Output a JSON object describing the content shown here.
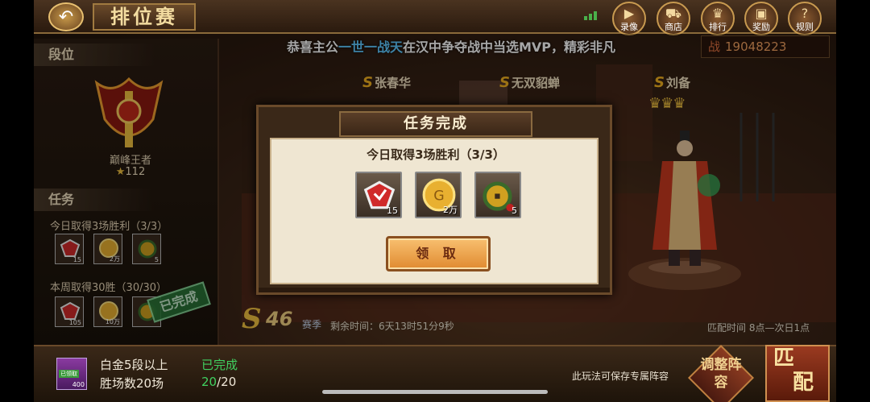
{
  "header": {
    "back_icon": "back-arrow-icon",
    "title": "排位赛",
    "nav": [
      {
        "label": "录像",
        "icon": "video-camera-icon"
      },
      {
        "label": "商店",
        "icon": "shopping-cart-icon"
      },
      {
        "label": "排行",
        "icon": "trophy-icon"
      },
      {
        "label": "奖励",
        "icon": "gift-icon"
      },
      {
        "label": "规则",
        "icon": "question-icon"
      }
    ]
  },
  "broadcast": {
    "prefix": "恭喜主公",
    "player": "一世一战天",
    "suffix": "在汉中争夺战中当选MVP，精彩非凡"
  },
  "power": {
    "label": "战",
    "value": "19048223"
  },
  "rank_panel": {
    "section_title": "段位",
    "rank_name": "巅峰王者",
    "stars": "112"
  },
  "tasks_panel": {
    "section_title": "任务",
    "tasks": [
      {
        "title": "今日取得3场胜利（3/3）",
        "rewards": [
          "15",
          "2万",
          "5"
        ]
      },
      {
        "title": "本周取得30胜（30/30）",
        "rewards": [
          "105",
          "10万",
          ""
        ],
        "stamp": "已完成"
      }
    ]
  },
  "arena": {
    "heroes": [
      "张春华",
      "无双貂蝉",
      "刘备"
    ],
    "season_letter": "S",
    "season_number": "46",
    "season_label": "赛季",
    "remaining": "剩余时间：6天13时51分9秒",
    "match_time": "匹配时间 8点—次日1点"
  },
  "dialog": {
    "title": "任务完成",
    "task": "今日取得3场胜利（3/3）",
    "rewards": [
      {
        "icon": "red-shield-token-icon",
        "count": "15"
      },
      {
        "icon": "gold-coin-icon",
        "count": "2万"
      },
      {
        "icon": "jade-coin-pendant-icon",
        "count": "5"
      }
    ],
    "claim_label": "领 取"
  },
  "bottom": {
    "icon_label": "已领取",
    "icon_count": "400",
    "line1": "白金5段以上",
    "line2": "胜场数20场",
    "status": "已完成",
    "progress_current": "20",
    "progress_total": "/20",
    "note": "此玩法可保存专属阵容",
    "adjust_label": "调整阵容",
    "match_label_1": "匹",
    "match_label_2": "配"
  },
  "colors": {
    "accent_gold": "#f0c040",
    "highlight_blue": "#5fc8ff",
    "complete_green": "#40d060",
    "dialog_paper": "#efe6d2"
  }
}
